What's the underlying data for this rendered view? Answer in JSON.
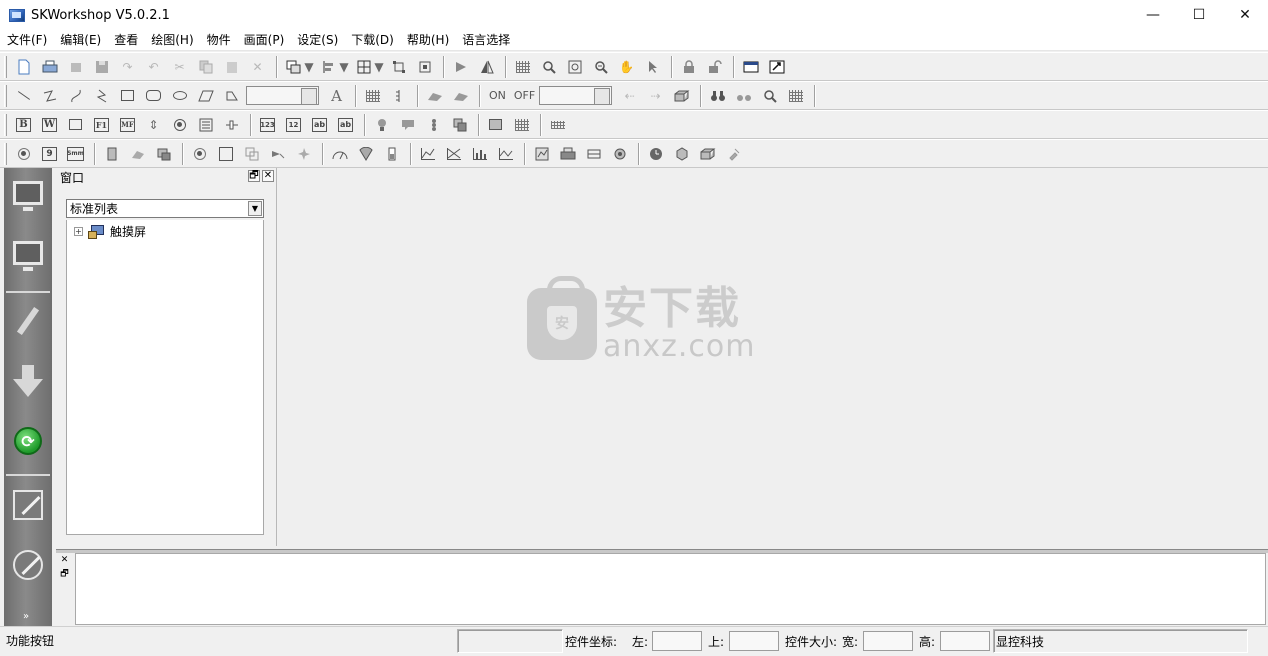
{
  "window": {
    "title": "SKWorkshop V5.0.2.1",
    "controls": {
      "minimize": "—",
      "maximize": "☐",
      "close": "✕"
    }
  },
  "menu": [
    "文件(F)",
    "编辑(E)",
    "查看",
    "绘图(H)",
    "物件",
    "画面(P)",
    "设定(S)",
    "下载(D)",
    "帮助(H)",
    "语言选择"
  ],
  "toolbar2": {
    "on_label": "ON",
    "off_label": "OFF"
  },
  "toolbar3": {
    "bold": "B",
    "word": "W",
    "func": "F1",
    "mf": "MF",
    "num": "123",
    "text": "ab"
  },
  "toolbar4": {
    "calendar": "9",
    "smm": "Smm"
  },
  "icons": {
    "new": "new-file-icon",
    "print": "print-icon",
    "save": "save-icon",
    "zoom_in": "zoom-in-icon",
    "hand": "pan-hand-icon",
    "pointer": "pointer-icon",
    "lock": "lock-icon",
    "line": "line-icon",
    "rectangle": "rectangle-icon"
  },
  "panel": {
    "title": "窗口",
    "restore": "🗗",
    "close": "✕",
    "selector_value": "标准列表",
    "tree": [
      {
        "label": "触摸屏",
        "expander": "+"
      }
    ]
  },
  "watermark": {
    "chinese": "安下载",
    "domain": "anxz.com",
    "shield": "安"
  },
  "output_panel": {
    "close": "✕",
    "restore": "🗗"
  },
  "statusbar": {
    "left": "功能按钮",
    "coord_label": "控件坐标:",
    "left_label": "左:",
    "top_label": "上:",
    "size_label": "控件大小:",
    "width_label": "宽:",
    "height_label": "高:",
    "company": "显控科技"
  },
  "leftbar": {
    "more": "»"
  }
}
